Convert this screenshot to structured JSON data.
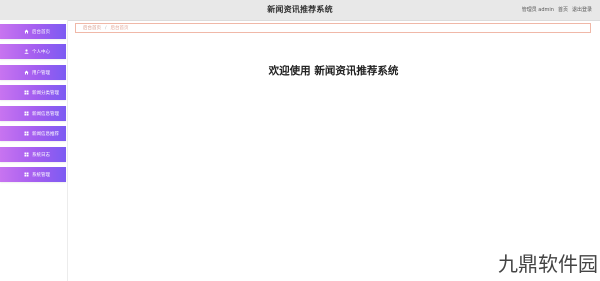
{
  "header": {
    "title": "新闻资讯推荐系统",
    "links": [
      "管理员 admin",
      "首页",
      "退出登录"
    ]
  },
  "sidebar": {
    "items": [
      {
        "label": "后台首页",
        "icon": "home-icon"
      },
      {
        "label": "个人中心",
        "icon": "user-icon"
      },
      {
        "label": "用户管理",
        "icon": "home-icon"
      },
      {
        "label": "新闻分类管理",
        "icon": "grid-icon"
      },
      {
        "label": "新闻信息管理",
        "icon": "grid-icon"
      },
      {
        "label": "新闻信息推荐",
        "icon": "grid-icon"
      },
      {
        "label": "系统日志",
        "icon": "grid-icon"
      },
      {
        "label": "系统管理",
        "icon": "grid-icon"
      }
    ]
  },
  "breadcrumb": {
    "home": "后台首页",
    "separator": "/",
    "current": "后台首页"
  },
  "main": {
    "welcome": "欢迎使用 新闻资讯推荐系统"
  },
  "watermark": "九鼎软件园",
  "colors": {
    "menu_gradient_start": "#c874f0",
    "menu_gradient_end": "#7c5bf2",
    "breadcrumb_border": "#f0b8a8"
  }
}
